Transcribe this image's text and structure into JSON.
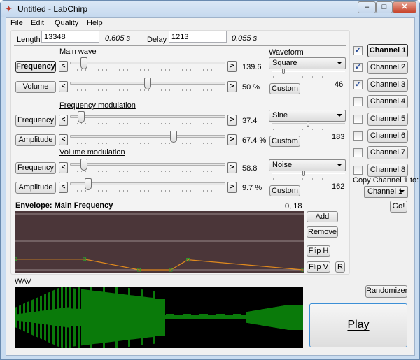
{
  "window": {
    "title": "Untitled - LabChirp"
  },
  "menu": [
    "File",
    "Edit",
    "Quality",
    "Help"
  ],
  "top": {
    "length_label": "Length",
    "length_value": "13348",
    "length_seconds": "0.605 s",
    "delay_label": "Delay",
    "delay_value": "1213",
    "delay_seconds": "0.055 s"
  },
  "sections": [
    {
      "title": "Main wave",
      "rows": [
        {
          "label": "Frequency",
          "value": "139.6",
          "position": 0.07,
          "bold": true
        },
        {
          "label": "Volume",
          "value": "50 %",
          "position": 0.5
        }
      ],
      "waveform": {
        "label": "Waveform",
        "selected": "Square",
        "custom": "Custom",
        "value": "46",
        "position": 0.15
      }
    },
    {
      "title": "Frequency modulation",
      "rows": [
        {
          "label": "Frequency",
          "value": "37.4",
          "position": 0.05
        },
        {
          "label": "Amplitude",
          "value": "67.4 %",
          "position": 0.674
        }
      ],
      "waveform": {
        "selected": "Sine",
        "custom": "Custom",
        "value": "183",
        "position": 0.5
      }
    },
    {
      "title": "Volume modulation",
      "rows": [
        {
          "label": "Frequency",
          "value": "58.8",
          "position": 0.07
        },
        {
          "label": "Amplitude",
          "value": "9.7 %",
          "position": 0.1
        }
      ],
      "waveform": {
        "selected": "Noise",
        "custom": "Custom",
        "value": "162",
        "position": 0.44
      }
    }
  ],
  "arrows": {
    "left": "<",
    "right": ">"
  },
  "channels": [
    {
      "label": "Channel 1",
      "checked": true,
      "active": true
    },
    {
      "label": "Channel 2",
      "checked": true
    },
    {
      "label": "Channel 3",
      "checked": true
    },
    {
      "label": "Channel 4",
      "checked": false
    },
    {
      "label": "Channel 5",
      "checked": false
    },
    {
      "label": "Channel 6",
      "checked": false
    },
    {
      "label": "Channel 7",
      "checked": false
    },
    {
      "label": "Channel 8",
      "checked": false
    }
  ],
  "copy": {
    "label": "Copy Channel 1 to:",
    "selected": "Channel 1",
    "go": "Go!"
  },
  "envelope": {
    "title": "Envelope: Main Frequency",
    "coords": "0, 18",
    "points": [
      [
        0,
        0.19
      ],
      [
        0.24,
        0.19
      ],
      [
        0.43,
        0
      ],
      [
        0.54,
        0
      ],
      [
        0.6,
        0.18
      ],
      [
        1,
        0
      ]
    ],
    "buttons": {
      "add": "Add",
      "remove": "Remove",
      "flip_h": "Flip H",
      "flip_v": "Flip V",
      "reset": "R"
    },
    "bg_color": "#4b3639",
    "line_color": "#e08a1e",
    "point_color": "#2e9e2e"
  },
  "wav": {
    "label": "WAV",
    "color": "#0a7a0a"
  },
  "randomizer": "Randomizer",
  "play": "Play"
}
